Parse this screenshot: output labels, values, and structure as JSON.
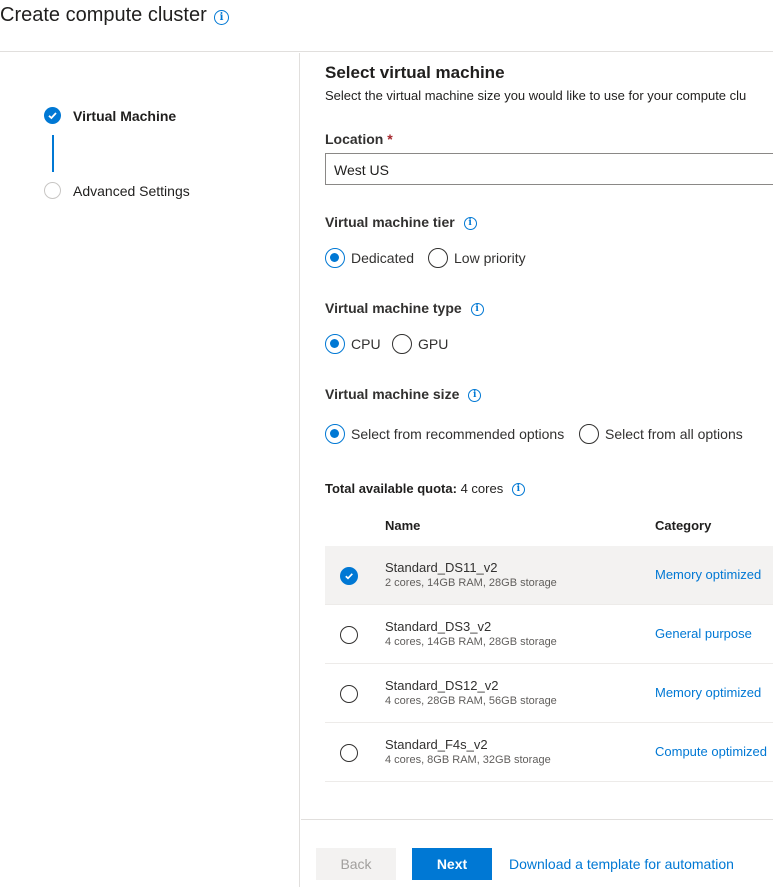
{
  "header": {
    "title": "Create compute cluster"
  },
  "steps": [
    {
      "label": "Virtual Machine",
      "state": "completed"
    },
    {
      "label": "Advanced Settings",
      "state": "pending"
    }
  ],
  "form": {
    "section_title": "Select virtual machine",
    "section_description": "Select the virtual machine size you would like to use for your compute clu",
    "location": {
      "label": "Location",
      "required_mark": "*",
      "value": "West US"
    },
    "tier": {
      "label": "Virtual machine tier",
      "options": [
        "Dedicated",
        "Low priority"
      ],
      "selected": "Dedicated"
    },
    "type": {
      "label": "Virtual machine type",
      "options": [
        "CPU",
        "GPU"
      ],
      "selected": "CPU"
    },
    "size": {
      "label": "Virtual machine size",
      "options": [
        "Select from recommended options",
        "Select from all options"
      ],
      "selected": "Select from recommended options"
    },
    "quota": {
      "label": "Total available quota:",
      "value": "4 cores"
    }
  },
  "table": {
    "columns": [
      "Name",
      "Category"
    ],
    "rows": [
      {
        "name": "Standard_DS11_v2",
        "specs": "2 cores, 14GB RAM, 28GB storage",
        "category": "Memory optimized",
        "selected": true
      },
      {
        "name": "Standard_DS3_v2",
        "specs": "4 cores, 14GB RAM, 28GB storage",
        "category": "General purpose",
        "selected": false
      },
      {
        "name": "Standard_DS12_v2",
        "specs": "4 cores, 28GB RAM, 56GB storage",
        "category": "Memory optimized",
        "selected": false
      },
      {
        "name": "Standard_F4s_v2",
        "specs": "4 cores, 8GB RAM, 32GB storage",
        "category": "Compute optimized",
        "selected": false
      }
    ]
  },
  "footer": {
    "back_label": "Back",
    "next_label": "Next",
    "template_link": "Download a template for automation"
  },
  "colors": {
    "accent": "#0078d4",
    "required": "#a4262c",
    "selected_row": "#f3f2f1"
  },
  "icons": {
    "info": "info-icon",
    "check": "checkmark-icon"
  }
}
